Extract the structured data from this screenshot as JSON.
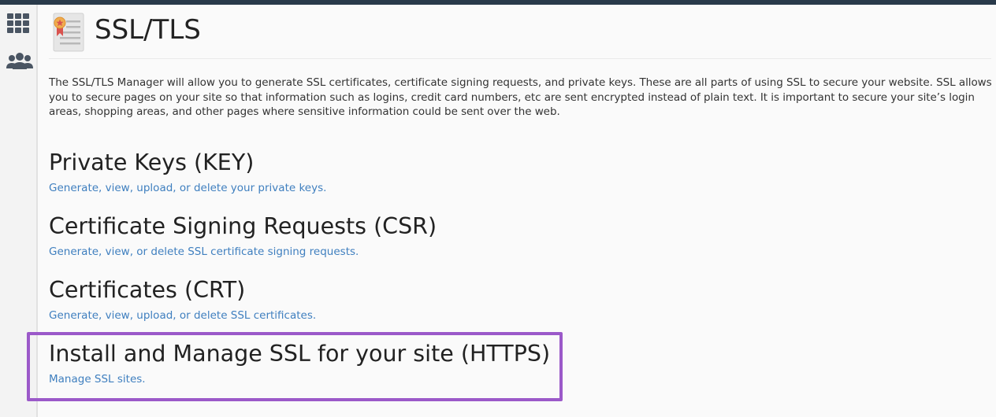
{
  "header": {
    "title": "SSL/TLS",
    "icon": "certificate-icon"
  },
  "sidebar": {
    "items": [
      {
        "name": "apps-grid-icon"
      },
      {
        "name": "users-icon"
      }
    ]
  },
  "intro": "The SSL/TLS Manager will allow you to generate SSL certificates, certificate signing requests, and private keys. These are all parts of using SSL to secure your website. SSL allows you to secure pages on your site so that information such as logins, credit card numbers, etc are sent encrypted instead of plain text. It is important to secure your site’s login areas, shopping areas, and other pages where sensitive information could be sent over the web.",
  "sections": [
    {
      "heading": "Private Keys (KEY)",
      "link": "Generate, view, upload, or delete your private keys."
    },
    {
      "heading": "Certificate Signing Requests (CSR)",
      "link": "Generate, view, or delete SSL certificate signing requests."
    },
    {
      "heading": "Certificates (CRT)",
      "link": "Generate, view, upload, or delete SSL certificates."
    },
    {
      "heading": "Install and Manage SSL for your site (HTTPS)",
      "link": "Manage SSL sites."
    }
  ],
  "colors": {
    "topbar": "#293a4a",
    "link": "#3f7fbf",
    "highlight": "#9b59c9"
  }
}
